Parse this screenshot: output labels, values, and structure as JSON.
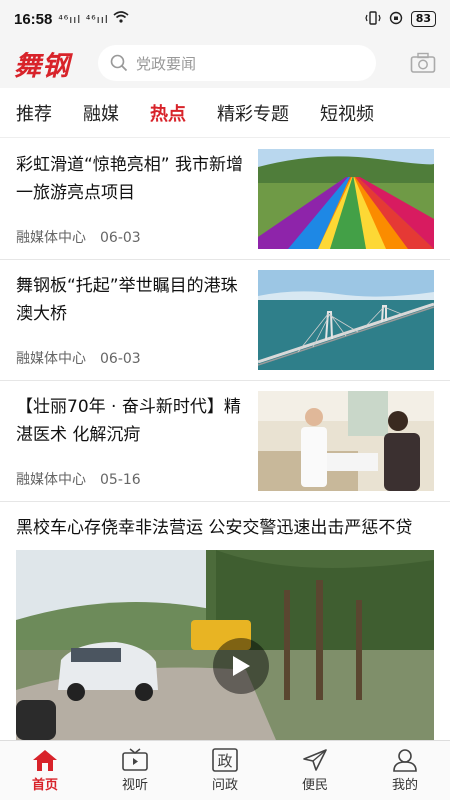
{
  "status": {
    "time": "16:58",
    "signal": "⁴⁶ııl ⁴⁶ııl",
    "battery": "83"
  },
  "header": {
    "logo": "舞钢",
    "search_placeholder": "党政要闻"
  },
  "tabs": [
    "推荐",
    "融媒",
    "热点",
    "精彩专题",
    "短视频"
  ],
  "active_tab": "热点",
  "news": [
    {
      "title": "彩虹滑道“惊艳亮相” 我市新增一旅游亮点项目",
      "source": "融媒体中心",
      "date": "06-03"
    },
    {
      "title": "舞钢板“托起”举世瞩目的港珠澳大桥",
      "source": "融媒体中心",
      "date": "06-03"
    },
    {
      "title": "【壮丽70年 · 奋斗新时代】精湛医术 化解沉疴",
      "source": "融媒体中心",
      "date": "05-16"
    }
  ],
  "video": {
    "title": "黑校车心存侥幸非法营运 公安交警迅速出击严惩不贷"
  },
  "bottom_nav": [
    {
      "label": "首页",
      "icon": "home-icon"
    },
    {
      "label": "视听",
      "icon": "tv-icon"
    },
    {
      "label": "问政",
      "icon": "zheng-icon",
      "glyph": "政"
    },
    {
      "label": "便民",
      "icon": "send-icon"
    },
    {
      "label": "我的",
      "icon": "user-icon"
    }
  ],
  "colors": {
    "accent": "#d8232a"
  }
}
